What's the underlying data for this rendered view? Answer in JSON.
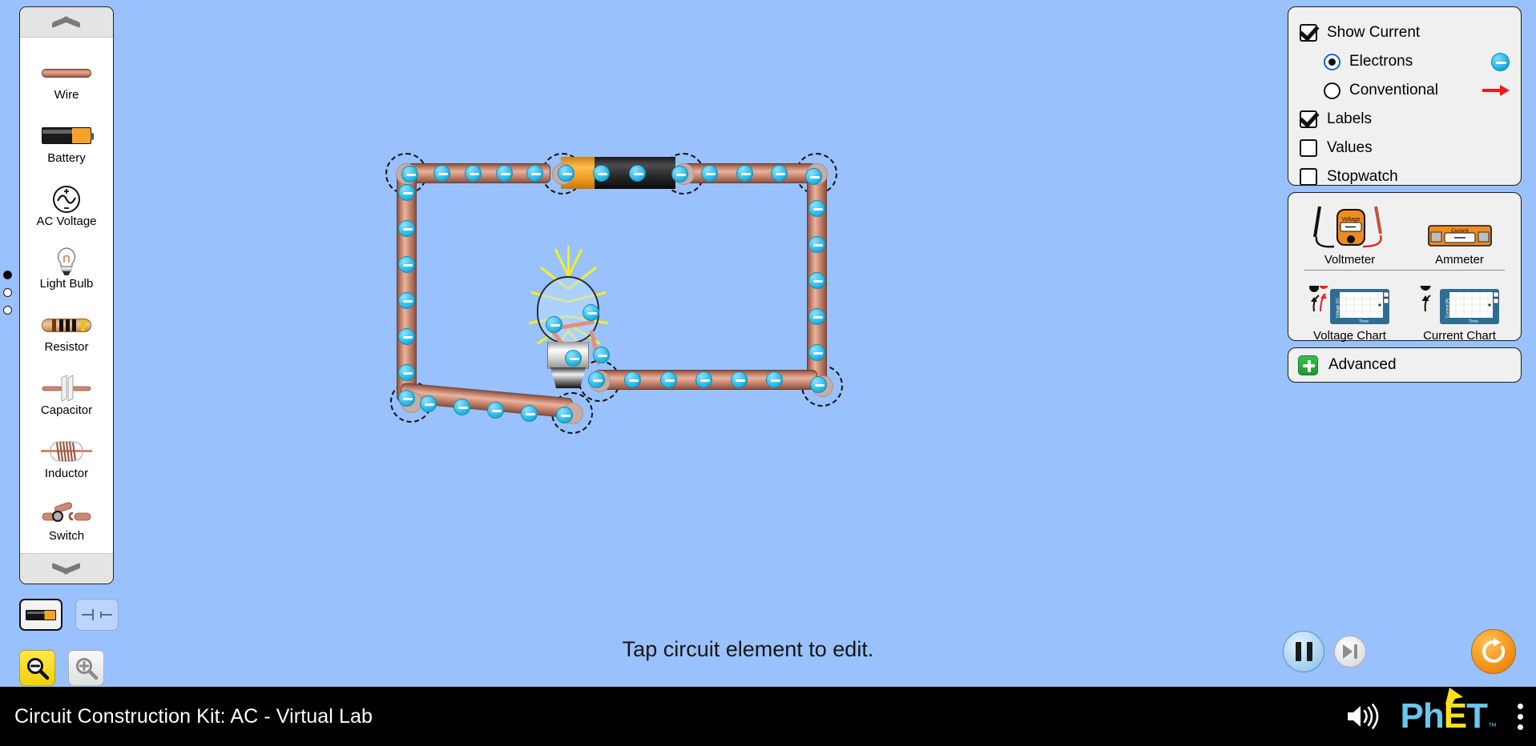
{
  "app": {
    "title": "Circuit Construction Kit: AC - Virtual Lab",
    "background_color": "#99c1fd",
    "hint": "Tap circuit element to edit."
  },
  "nav_dots": [
    {
      "name": "screen-1",
      "active": true
    },
    {
      "name": "screen-2",
      "active": false
    },
    {
      "name": "screen-3",
      "active": false
    }
  ],
  "toolbox": {
    "scroll_up_icon": "chevron-up-icon",
    "scroll_down_icon": "chevron-down-icon",
    "items": [
      {
        "label": "Wire",
        "icon": "wire-icon"
      },
      {
        "label": "Battery",
        "icon": "battery-icon"
      },
      {
        "label": "AC Voltage",
        "icon": "ac-voltage-icon"
      },
      {
        "label": "Light Bulb",
        "icon": "light-bulb-icon"
      },
      {
        "label": "Resistor",
        "icon": "resistor-icon"
      },
      {
        "label": "Capacitor",
        "icon": "capacitor-icon"
      },
      {
        "label": "Inductor",
        "icon": "inductor-icon"
      },
      {
        "label": "Switch",
        "icon": "switch-icon"
      }
    ]
  },
  "view_toggle": {
    "options": [
      {
        "name": "lifelike",
        "icon": "battery-lifelike-icon",
        "selected": true
      },
      {
        "name": "schematic",
        "icon": "battery-schematic-icon",
        "selected": false
      }
    ]
  },
  "zoom_controls": [
    {
      "name": "zoom-out",
      "icon": "magnifier-minus-icon",
      "active": true
    },
    {
      "name": "zoom-in",
      "icon": "magnifier-plus-icon",
      "active": false
    }
  ],
  "display_panel": {
    "show_current": {
      "label": "Show Current",
      "checked": true
    },
    "current_type": {
      "options": [
        {
          "label": "Electrons",
          "selected": true,
          "symbol": "electron-symbol"
        },
        {
          "label": "Conventional",
          "selected": false,
          "symbol": "arrow-symbol"
        }
      ]
    },
    "labels": {
      "label": "Labels",
      "checked": true
    },
    "values": {
      "label": "Values",
      "checked": false
    },
    "stopwatch": {
      "label": "Stopwatch",
      "checked": false
    }
  },
  "meters_panel": {
    "items": [
      {
        "label": "Voltmeter",
        "icon": "voltmeter-icon",
        "readout": "Voltage"
      },
      {
        "label": "Ammeter",
        "icon": "ammeter-icon",
        "readout": "Current"
      },
      {
        "label": "Voltage Chart",
        "icon": "voltage-chart-icon",
        "axis_y": "Voltage (V)",
        "axis_x": "Time"
      },
      {
        "label": "Current Chart",
        "icon": "current-chart-icon",
        "axis_y": "Current (A)",
        "axis_x": "Time"
      }
    ]
  },
  "advanced_panel": {
    "label": "Advanced",
    "expand_icon": "plus-icon",
    "expanded": false,
    "accent_color": "#28a745"
  },
  "time_controls": {
    "pause": {
      "name": "pause-button",
      "icon": "pause-icon",
      "active": true
    },
    "step": {
      "name": "step-forward-button",
      "icon": "step-forward-icon",
      "enabled": false
    }
  },
  "reset_button": {
    "name": "reset-all-button",
    "icon": "reset-icon",
    "color": "#f28f17"
  },
  "navbar": {
    "sound_icon": "sound-on-icon",
    "logo": {
      "part1": "Ph",
      "part2": "E",
      "part3": "T",
      "tm": "™"
    },
    "menu_icon": "kebab-menu-icon"
  },
  "circuit": {
    "electron_color": "#1fb3e4",
    "wire_color": "#c07e67",
    "elements": [
      {
        "type": "battery",
        "selected": true,
        "positive_end": "left-orange",
        "negative_end": "right-black"
      },
      {
        "type": "light-bulb",
        "lit": true,
        "glow_color": "#f5ef23"
      },
      {
        "type": "wire",
        "count": 5
      }
    ]
  }
}
